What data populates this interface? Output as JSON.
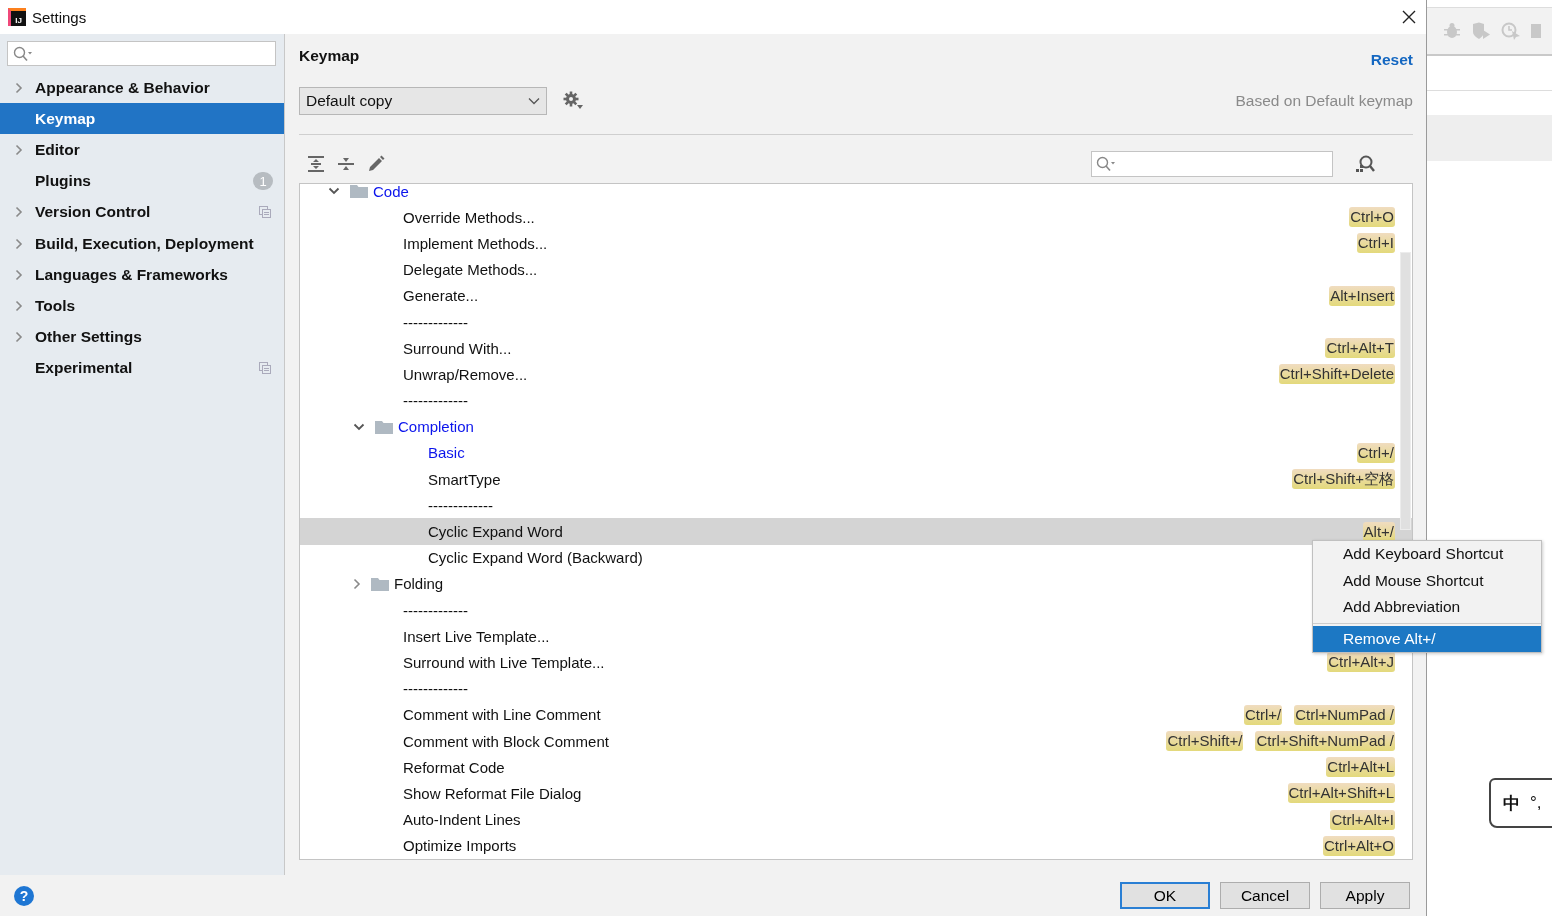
{
  "window": {
    "title": "Settings",
    "logo_text": "IJ"
  },
  "sidebar": {
    "items": [
      {
        "label": "Appearance & Behavior",
        "expandable": true,
        "selected": false,
        "project_icon": false
      },
      {
        "label": "Keymap",
        "expandable": false,
        "selected": true,
        "project_icon": false
      },
      {
        "label": "Editor",
        "expandable": true,
        "selected": false,
        "project_icon": false
      },
      {
        "label": "Plugins",
        "expandable": false,
        "selected": false,
        "badge": "1",
        "project_icon": false
      },
      {
        "label": "Version Control",
        "expandable": true,
        "selected": false,
        "project_icon": true
      },
      {
        "label": "Build, Execution, Deployment",
        "expandable": true,
        "selected": false,
        "project_icon": false
      },
      {
        "label": "Languages & Frameworks",
        "expandable": true,
        "selected": false,
        "project_icon": false
      },
      {
        "label": "Tools",
        "expandable": true,
        "selected": false,
        "project_icon": false
      },
      {
        "label": "Other Settings",
        "expandable": true,
        "selected": false,
        "project_icon": false
      },
      {
        "label": "Experimental",
        "expandable": false,
        "selected": false,
        "project_icon": true
      }
    ]
  },
  "keymap": {
    "title": "Keymap",
    "reset": "Reset",
    "scheme": "Default copy",
    "based_on": "Based on Default keymap",
    "tree": [
      {
        "kind": "group",
        "name": "Code",
        "modified": true,
        "expanded": true,
        "selected": false,
        "children": [
          {
            "kind": "action",
            "name": "Override Methods...",
            "modified": false,
            "selected": false,
            "shortcuts": [
              "Ctrl+O"
            ]
          },
          {
            "kind": "action",
            "name": "Implement Methods...",
            "modified": false,
            "selected": false,
            "shortcuts": [
              "Ctrl+I"
            ]
          },
          {
            "kind": "action",
            "name": "Delegate Methods...",
            "modified": false,
            "selected": false
          },
          {
            "kind": "action",
            "name": "Generate...",
            "modified": false,
            "selected": false,
            "shortcuts": [
              "Alt+Insert"
            ]
          },
          {
            "kind": "separator",
            "name": "-------------"
          },
          {
            "kind": "action",
            "name": "Surround With...",
            "modified": false,
            "selected": false,
            "shortcuts": [
              "Ctrl+Alt+T"
            ]
          },
          {
            "kind": "action",
            "name": "Unwrap/Remove...",
            "modified": false,
            "selected": false,
            "shortcuts": [
              "Ctrl+Shift+Delete"
            ]
          },
          {
            "kind": "separator",
            "name": "-------------"
          },
          {
            "kind": "group",
            "name": "Completion",
            "modified": true,
            "expanded": true,
            "selected": false,
            "children": [
              {
                "kind": "action",
                "name": "Basic",
                "modified": true,
                "selected": false,
                "shortcuts": [
                  "Ctrl+/"
                ]
              },
              {
                "kind": "action",
                "name": "SmartType",
                "modified": false,
                "selected": false,
                "shortcuts": [
                  "Ctrl+Shift+空格"
                ]
              },
              {
                "kind": "separator",
                "name": "-------------"
              },
              {
                "kind": "action",
                "name": "Cyclic Expand Word",
                "modified": false,
                "selected": true,
                "shortcuts": [
                  "Alt+/"
                ]
              },
              {
                "kind": "action",
                "name": "Cyclic Expand Word (Backward)",
                "modified": false,
                "selected": false
              }
            ]
          },
          {
            "kind": "group",
            "name": "Folding",
            "modified": false,
            "expanded": false,
            "selected": false
          },
          {
            "kind": "separator",
            "name": "-------------"
          },
          {
            "kind": "action",
            "name": "Insert Live Template...",
            "modified": false,
            "selected": false
          },
          {
            "kind": "action",
            "name": "Surround with Live Template...",
            "modified": false,
            "selected": false,
            "shortcuts": [
              "Ctrl+Alt+J"
            ]
          },
          {
            "kind": "separator",
            "name": "-------------"
          },
          {
            "kind": "action",
            "name": "Comment with Line Comment",
            "modified": false,
            "selected": false,
            "shortcuts": [
              "Ctrl+/",
              "Ctrl+NumPad /"
            ]
          },
          {
            "kind": "action",
            "name": "Comment with Block Comment",
            "modified": false,
            "selected": false,
            "shortcuts": [
              "Ctrl+Shift+/",
              "Ctrl+Shift+NumPad /"
            ]
          },
          {
            "kind": "action",
            "name": "Reformat Code",
            "modified": false,
            "selected": false,
            "shortcuts": [
              "Ctrl+Alt+L"
            ]
          },
          {
            "kind": "action",
            "name": "Show Reformat File Dialog",
            "modified": false,
            "selected": false,
            "shortcuts": [
              "Ctrl+Alt+Shift+L"
            ]
          },
          {
            "kind": "action",
            "name": "Auto-Indent Lines",
            "modified": false,
            "selected": false,
            "shortcuts": [
              "Ctrl+Alt+I"
            ]
          },
          {
            "kind": "action",
            "name": "Optimize Imports",
            "modified": false,
            "selected": false,
            "shortcuts": [
              "Ctrl+Alt+O"
            ]
          }
        ]
      }
    ]
  },
  "context_menu": {
    "items": [
      {
        "label": "Add Keyboard Shortcut",
        "selected": false
      },
      {
        "label": "Add Mouse Shortcut",
        "selected": false
      },
      {
        "label": "Add Abbreviation",
        "selected": false
      },
      {
        "kind": "separator"
      },
      {
        "label": "Remove Alt+/",
        "selected": true
      }
    ]
  },
  "buttons": [
    {
      "label": "OK",
      "default": true
    },
    {
      "label": "Cancel",
      "default": false
    },
    {
      "label": "Apply",
      "default": false
    }
  ],
  "help": "?",
  "ime": {
    "mode": "中",
    "punct": "°,"
  }
}
